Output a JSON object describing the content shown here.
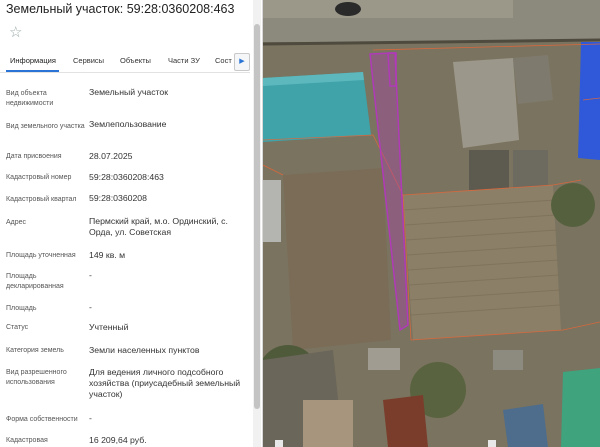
{
  "panel": {
    "title": "Земельный участок: 59:28:0360208:463",
    "star_icon": "star-outline-icon",
    "tabs": [
      {
        "label": "Информация",
        "active": true
      },
      {
        "label": "Сервисы"
      },
      {
        "label": "Объекты"
      },
      {
        "label": "Части ЗУ"
      },
      {
        "label": "Сост"
      }
    ],
    "tab_scroll_icon": "triangle-right-icon",
    "rows": [
      {
        "label": "Вид объекта недвижимости",
        "value": "Земельный участок"
      },
      {
        "label": "Вид земельного участка",
        "value": "Землепользование"
      },
      {
        "label": "Дата присвоения",
        "value": "28.07.2025"
      },
      {
        "label": "Кадастровый номер",
        "value": "59:28:0360208:463"
      },
      {
        "label": "Кадастровый квартал",
        "value": "59:28:0360208"
      },
      {
        "label": "Адрес",
        "value": "Пермский край, м.о. Ординский, с. Орда, ул. Советская"
      },
      {
        "label": "Площадь уточненная",
        "value": "149 кв. м"
      },
      {
        "label": "Площадь декларированная",
        "value": "-"
      },
      {
        "label": "Площадь",
        "value": "-"
      },
      {
        "label": "Статус",
        "value": "Учтенный"
      },
      {
        "label": "Категория земель",
        "value": "Земли населенных пунктов"
      },
      {
        "label": "Вид разрешенного использования",
        "value": "Для ведения личного подсобного хозяйства (приусадебный земельный участок)"
      },
      {
        "label": "Форма собственности",
        "value": "-"
      },
      {
        "label": "Кадастровая",
        "value": "16 209,64 руб."
      }
    ]
  },
  "map": {
    "parcel_color": "#b03ab8",
    "boundary_color": "#e0673a",
    "roof_teal": "#3fa3a9",
    "roof_blue": "#2f59d8"
  }
}
